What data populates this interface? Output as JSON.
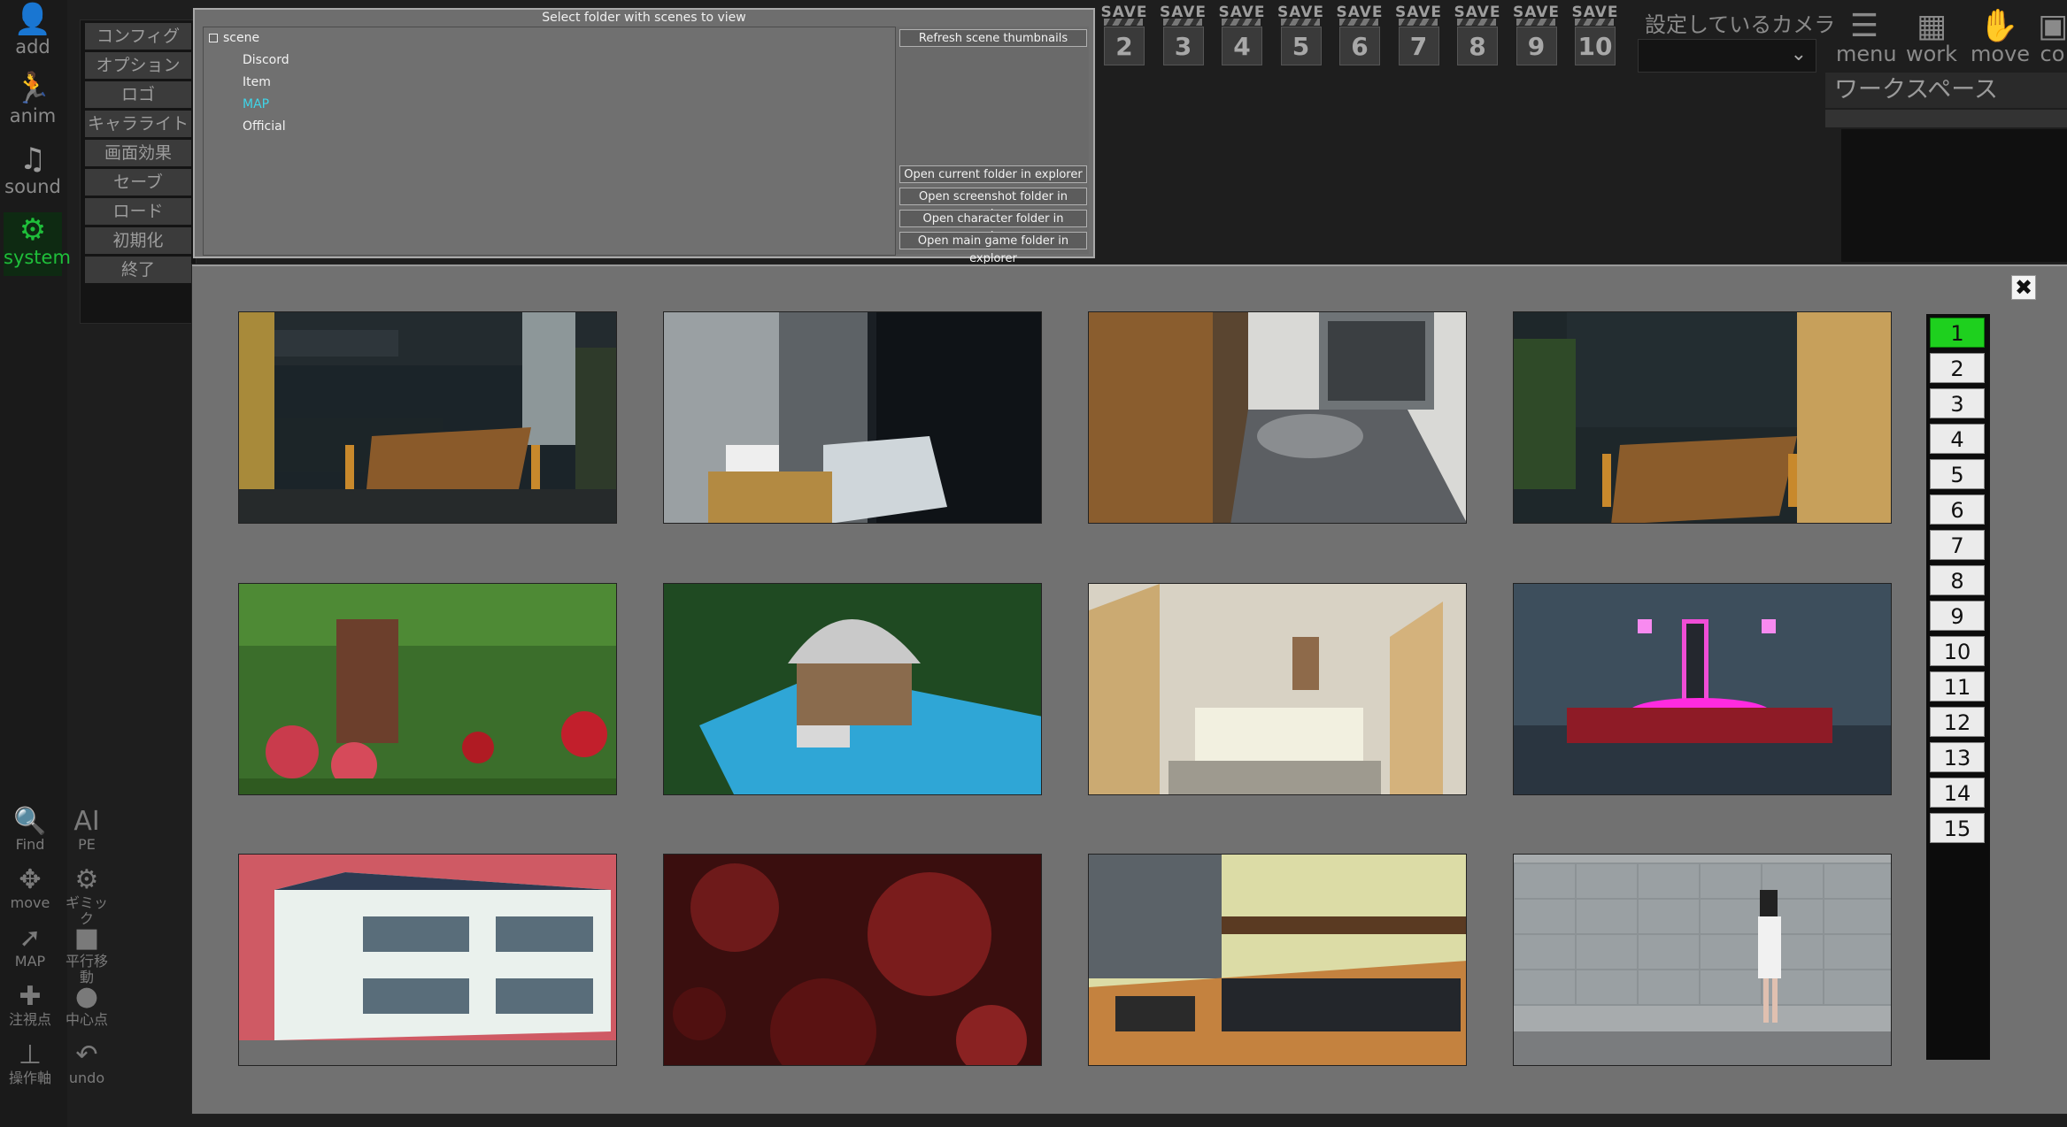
{
  "left_bar": [
    {
      "label": "add",
      "glyph": "👤"
    },
    {
      "label": "anim",
      "glyph": "🏃"
    },
    {
      "label": "sound",
      "glyph": "♫"
    },
    {
      "label": "system",
      "glyph": "⚙"
    }
  ],
  "menu_items": [
    "コンフィグ",
    "オプション",
    "ロゴ",
    "キャラライト",
    "画面効果",
    "セーブ",
    "ロード",
    "初期化",
    "終了"
  ],
  "save_slots": [
    {
      "label": "SAVE",
      "num": "2"
    },
    {
      "label": "SAVE",
      "num": "3"
    },
    {
      "label": "SAVE",
      "num": "4"
    },
    {
      "label": "SAVE",
      "num": "5"
    },
    {
      "label": "SAVE",
      "num": "6"
    },
    {
      "label": "SAVE",
      "num": "7"
    },
    {
      "label": "SAVE",
      "num": "8"
    },
    {
      "label": "SAVE",
      "num": "9"
    },
    {
      "label": "SAVE",
      "num": "10"
    }
  ],
  "camera_label": "設定しているカメラ",
  "top_icons": [
    {
      "label": "menu",
      "glyph": "☰"
    },
    {
      "label": "work",
      "glyph": "▦"
    },
    {
      "label": "move",
      "glyph": "✋"
    },
    {
      "label": "co",
      "glyph": "▣"
    }
  ],
  "workspace_title": "ワークスペース",
  "folder_dialog": {
    "title": "Select folder with scenes to view",
    "root": "scene",
    "folders": [
      "Discord",
      "Item",
      "MAP",
      "Official"
    ],
    "selected": "MAP",
    "buttons": {
      "refresh": "Refresh scene thumbnails",
      "open_current": "Open current folder in explorer",
      "open_screenshot": "Open screenshot folder in explorer",
      "open_character": "Open character folder in explorer",
      "open_main": "Open main game folder in explorer"
    }
  },
  "close_glyph": "✖",
  "thumbnails": [
    {
      "name": "kitchen-dining"
    },
    {
      "name": "bathroom"
    },
    {
      "name": "bedroom"
    },
    {
      "name": "dining-bookshelf"
    },
    {
      "name": "garden-roses"
    },
    {
      "name": "gazebo-pool"
    },
    {
      "name": "hospital-room"
    },
    {
      "name": "neon-meeting-room"
    },
    {
      "name": "apartment-building"
    },
    {
      "name": "red-texture"
    },
    {
      "name": "tatami-restaurant"
    },
    {
      "name": "block-wall-girl"
    }
  ],
  "pages": [
    "1",
    "2",
    "3",
    "4",
    "5",
    "6",
    "7",
    "8",
    "9",
    "10",
    "11",
    "12",
    "13",
    "14",
    "15"
  ],
  "current_page": "1",
  "tools": [
    {
      "label": "Find",
      "glyph": "🔍"
    },
    {
      "label": "PE",
      "glyph": "AI"
    },
    {
      "label": "move",
      "glyph": "✥"
    },
    {
      "label": "ギミック",
      "glyph": "⚙"
    },
    {
      "label": "MAP",
      "glyph": "➚"
    },
    {
      "label": "平行移動",
      "glyph": "■"
    },
    {
      "label": "注視点",
      "glyph": "✚"
    },
    {
      "label": "中心点",
      "glyph": "●"
    },
    {
      "label": "操作軸",
      "glyph": "⊥"
    },
    {
      "label": "undo",
      "glyph": "↶"
    }
  ]
}
